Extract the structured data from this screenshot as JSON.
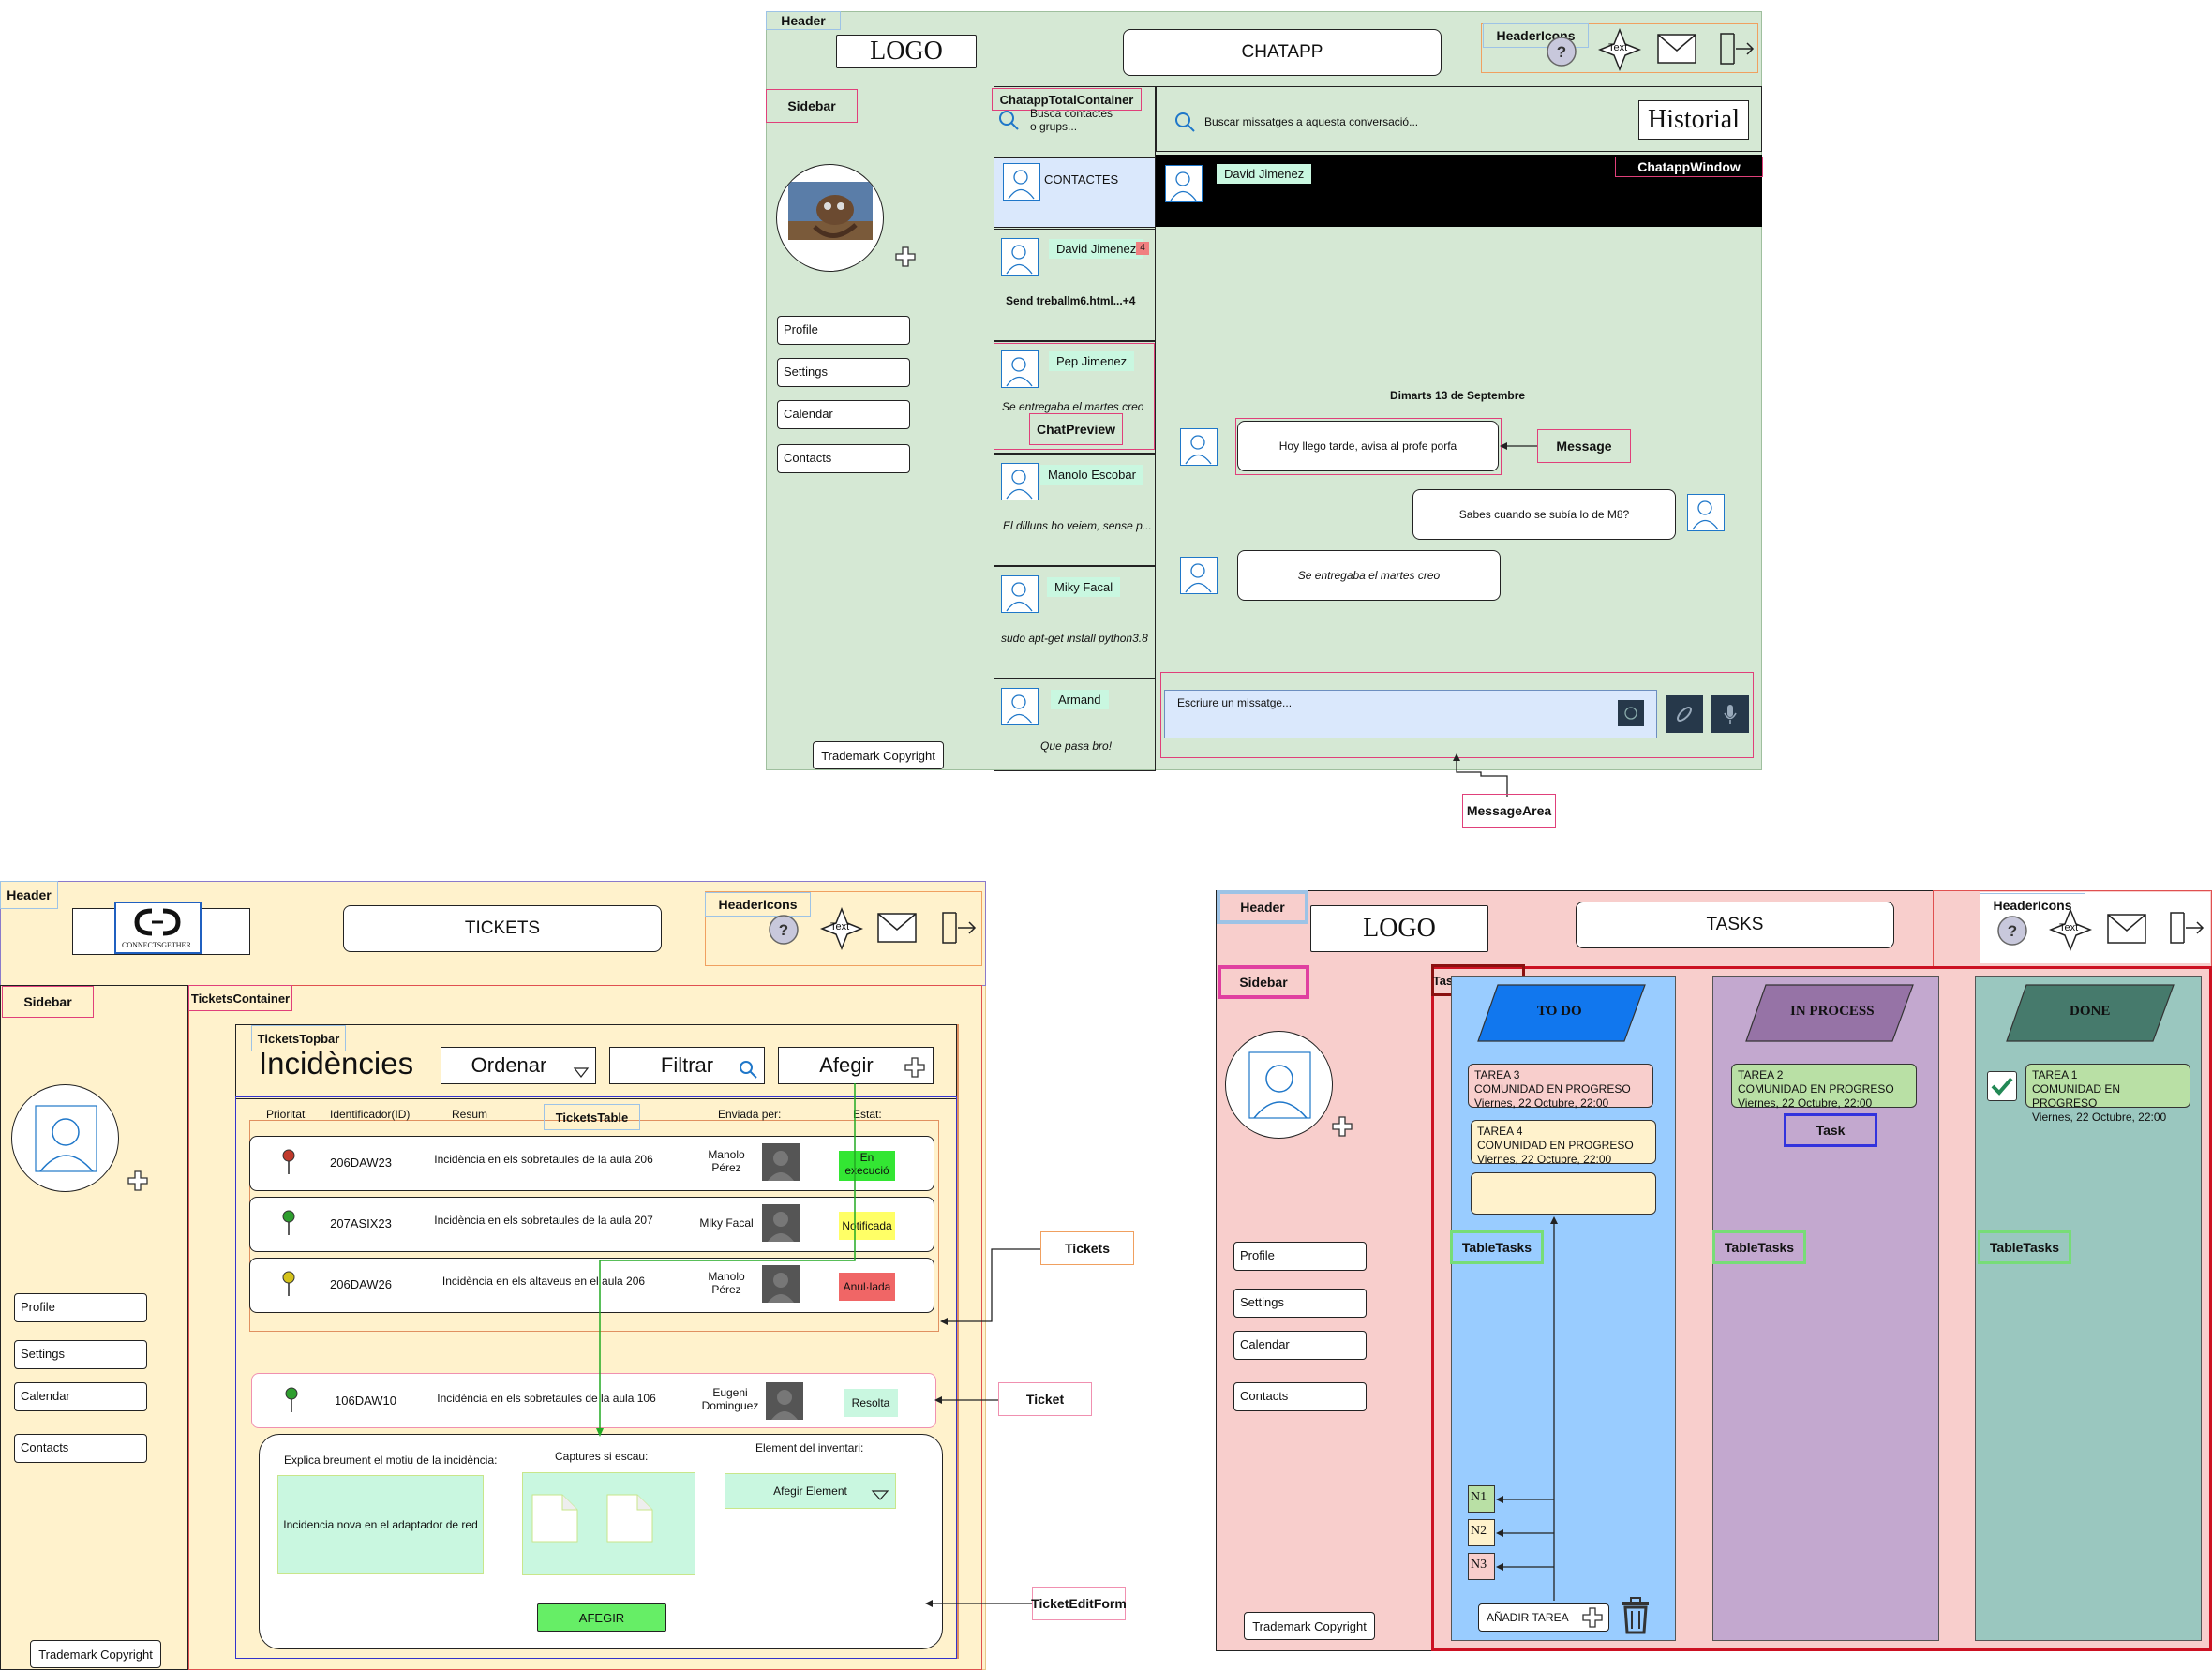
{
  "chatapp": {
    "header_label": "Header",
    "logo": "LOGO",
    "title": "CHATAPP",
    "header_icons_label": "HeaderIcons",
    "text_icon": "Text",
    "sidebar_label": "Sidebar",
    "sidebar_items": [
      "Profile",
      "Settings",
      "Calendar",
      "Contacts"
    ],
    "copyright": "Trademark Copyright",
    "total_container_label": "ChatappTotalContainer",
    "search_contacts": "Busca contactes o grups...",
    "search_messages": "Buscar missatges a aquesta conversació...",
    "historial": "Historial",
    "contacts_header": "CONTACTES",
    "window_label": "ChatappWindow",
    "window_contact": "David Jimenez",
    "chat_preview_label": "ChatPreview",
    "contacts": [
      {
        "name": "David Jimenez",
        "preview": "Send treballm6.html...+4",
        "badge": "4"
      },
      {
        "name": "Pep Jimenez",
        "preview": "Se entregaba el martes creo"
      },
      {
        "name": "Manolo Escobar",
        "preview": "El dilluns ho veiem, sense p..."
      },
      {
        "name": "Miky Facal",
        "preview": "sudo apt-get install python3.8"
      },
      {
        "name": "Armand",
        "preview": "Que pasa bro!"
      }
    ],
    "date": "Dimarts 13 de Septembre",
    "messages": [
      "Hoy llego tarde, avisa al profe porfa",
      "Sabes cuando se subía lo de M8?",
      "Se entregaba el martes creo"
    ],
    "message_label": "Message",
    "input_placeholder": "Escriure un missatge...",
    "message_area_label": "MessageArea"
  },
  "tickets": {
    "header_label": "Header",
    "logo_text": "CONNECTSGETHER",
    "title": "TICKETS",
    "header_icons_label": "HeaderIcons",
    "text_icon": "Text",
    "sidebar_label": "Sidebar",
    "sidebar_items": [
      "Profile",
      "Settings",
      "Calendar",
      "Contacts"
    ],
    "copyright": "Trademark Copyright",
    "container_label": "TicketsContainer",
    "topbar_label": "TicketsTopbar",
    "heading": "Incidències",
    "ordenar": "Ordenar",
    "filtrar": "Filtrar",
    "afegir": "Afegir",
    "table_label": "TicketsTable",
    "columns": [
      "Prioritat",
      "Identificador(ID)",
      "Resum",
      "Enviada per:",
      "Estat:"
    ],
    "rows": [
      {
        "id": "206DAW23",
        "resum": "Incidència en els sobretaules de la aula 206",
        "sender": "Manolo Pérez",
        "estat": "En execució",
        "pin": "#c0392b",
        "color": "#33e633"
      },
      {
        "id": "207ASIX23",
        "resum": "Incidència en els sobretaules de la aula 207",
        "sender": "Mlky Facal",
        "estat": "Notificada",
        "pin": "#2e9e2e",
        "color": "#ffff66"
      },
      {
        "id": "206DAW26",
        "resum": "Incidència en els altaveus en el aula 206",
        "sender": "Manolo Pérez",
        "estat": "Anul·lada",
        "pin": "#d4c21a",
        "color": "#f06666"
      }
    ],
    "tickets_label": "Tickets",
    "single": {
      "id": "106DAW10",
      "resum": "Incidència en els sobretaules de la aula 106",
      "sender": "Eugeni Dominguez",
      "estat": "Resolta",
      "pin": "#2e9e2e",
      "color": "#c9f7e0"
    },
    "ticket_label": "Ticket",
    "form": {
      "motiu_label": "Explica breument el motiu de la incidència:",
      "motiu_value": "Incidencia nova en el adaptador de red",
      "captures_label": "Captures si escau:",
      "element_label": "Element del inventari:",
      "element_value": "Afegir Element",
      "submit": "AFEGIR"
    },
    "edit_form_label": "TicketEditForm"
  },
  "tasks": {
    "header_label": "Header",
    "logo": "LOGO",
    "title": "TASKS",
    "header_icons_label": "HeaderIcons",
    "text_icon": "Text",
    "sidebar_label": "Sidebar",
    "sidebar_items": [
      "Profile",
      "Settings",
      "Calendar",
      "Contacts"
    ],
    "copyright": "Trademark Copyright",
    "container_label": "TasksContainer",
    "columns": [
      "TO DO",
      "IN PROCESS",
      "DONE"
    ],
    "table_label": "TableTasks",
    "todo": [
      {
        "line1": "TAREA 3",
        "line2": "COMUNIDAD EN PROGRESO",
        "line3": "Viernes, 22 Octubre, 22:00"
      },
      {
        "line1": "TAREA 4",
        "line2": "COMUNIDAD EN PROGRESO",
        "line3": "Viernes, 22 Octubre, 22:00"
      }
    ],
    "inprocess": [
      {
        "line1": "TAREA 2",
        "line2": "COMUNIDAD EN PROGRESO",
        "line3": "Viernes, 22 Octubre, 22:00"
      }
    ],
    "done": [
      {
        "line1": "TAREA 1",
        "line2": "COMUNIDAD EN PROGRESO",
        "line3": "Viernes, 22 Octubre, 22:00"
      }
    ],
    "task_label": "Task",
    "legend": [
      "N1",
      "N2",
      "N3"
    ],
    "add_task": "AÑADIR TAREA"
  }
}
